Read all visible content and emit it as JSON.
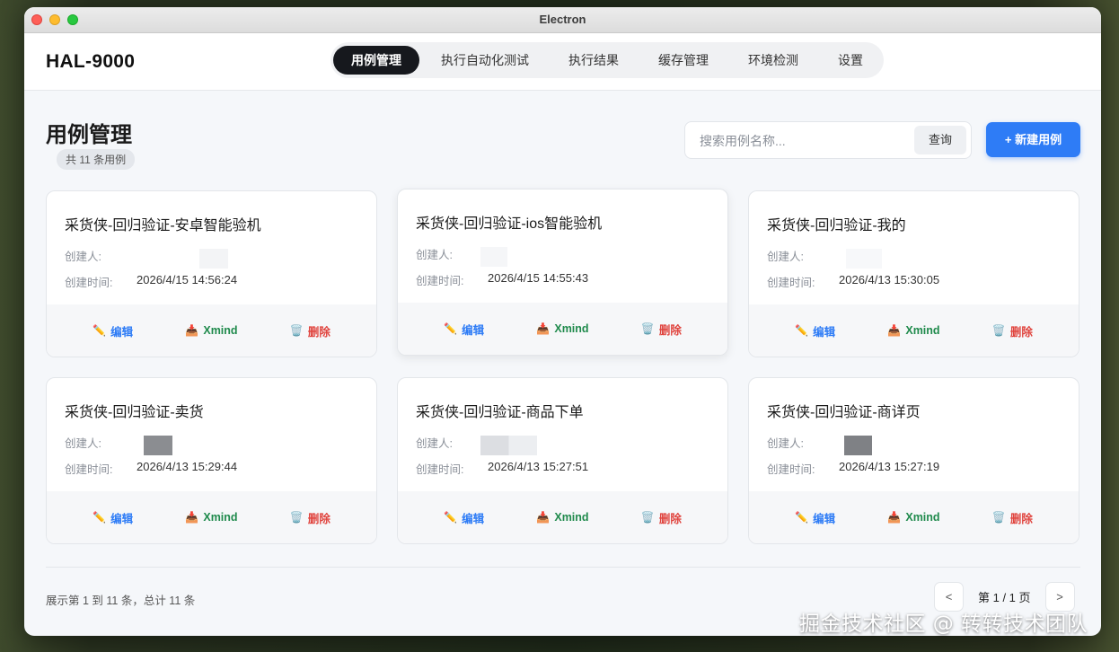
{
  "window": {
    "title": "Electron"
  },
  "header": {
    "brand": "HAL-9000",
    "tabs": [
      {
        "label": "用例管理",
        "active": true
      },
      {
        "label": "执行自动化测试",
        "active": false
      },
      {
        "label": "执行结果",
        "active": false
      },
      {
        "label": "缓存管理",
        "active": false
      },
      {
        "label": "环境检测",
        "active": false
      },
      {
        "label": "设置",
        "active": false
      }
    ]
  },
  "page": {
    "title": "用例管理",
    "count_badge": "共 11 条用例"
  },
  "search": {
    "placeholder": "搜索用例名称...",
    "button": "查询"
  },
  "new_button": "+ 新建用例",
  "labels": {
    "creator": "创建人:",
    "created_time": "创建时间:"
  },
  "actions": {
    "edit": "编辑",
    "xmind": "Xmind",
    "delete": "删除"
  },
  "cards": [
    {
      "title": "采货侠-回归验证-安卓智能验机",
      "time": "2026/4/15 14:56:24"
    },
    {
      "title": "采货侠-回归验证-ios智能验机",
      "time": "2026/4/15 14:55:43"
    },
    {
      "title": "采货侠-回归验证-我的",
      "time": "2026/4/13 15:30:05"
    },
    {
      "title": "采货侠-回归验证-卖货",
      "time": "2026/4/13 15:29:44"
    },
    {
      "title": "采货侠-回归验证-商品下单",
      "time": "2026/4/13 15:27:51"
    },
    {
      "title": "采货侠-回归验证-商详页",
      "time": "2026/4/13 15:27:19"
    }
  ],
  "footer": {
    "summary": "展示第 1 到 11 条，总计 11 条",
    "prev": "<",
    "page_text": "第 1 / 1 页",
    "next": ">"
  },
  "watermark": "掘金技术社区 @ 转转技术团队",
  "colors": {
    "primary": "#2e7cf6",
    "active_tab": "#16181d",
    "delete": "#e0443e",
    "xmind": "#1f8a4c"
  }
}
